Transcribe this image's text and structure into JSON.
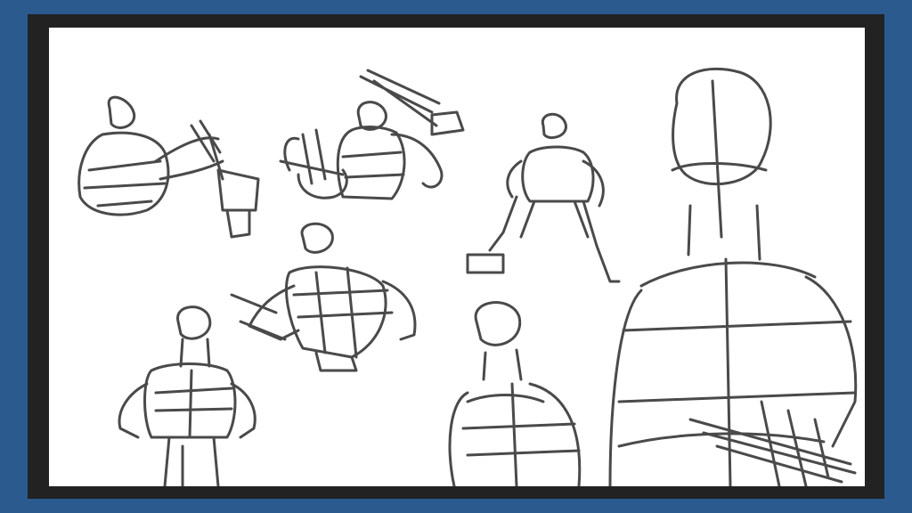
{
  "colors": {
    "background": "#2a5a8e",
    "frame": "#222222",
    "canvas": "#ffffff",
    "stroke": "#4a4a4a"
  },
  "figures": [
    {
      "name": "crouching-figure-top-left"
    },
    {
      "name": "figure-swinging-sword"
    },
    {
      "name": "figure-wide-stance-hammer"
    },
    {
      "name": "figure-back-view-reaching"
    },
    {
      "name": "figure-front-standing"
    },
    {
      "name": "figure-bust-back-view"
    },
    {
      "name": "large-figure-back-view-right"
    }
  ]
}
